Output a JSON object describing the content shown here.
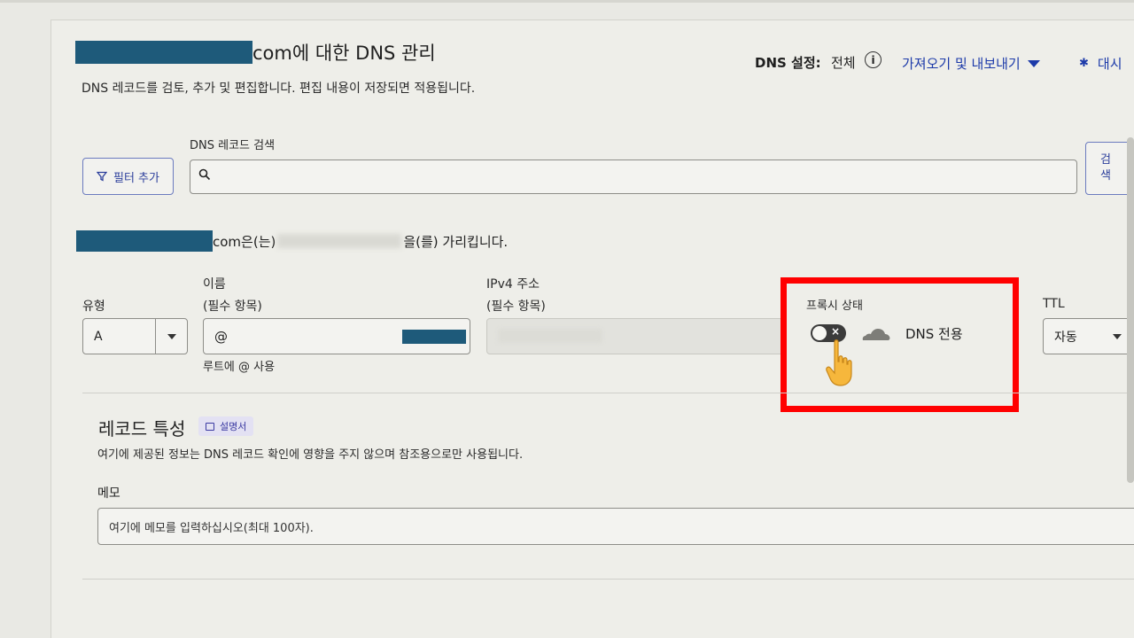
{
  "header": {
    "title_suffix": "com에 대한 DNS 관리",
    "subtitle": "DNS 레코드를 검토, 추가 및 편집합니다. 편집 내용이 저장되면 적용됩니다.",
    "dns_setting_label": "DNS 설정:",
    "dns_setting_value": "전체",
    "import_export_label": "가져오기 및 내보내기",
    "dashboard_label": "대시"
  },
  "search": {
    "label": "DNS 레코드 검색",
    "filter_label": "필터 추가",
    "button_line1": "검",
    "button_line2": "색",
    "value": ""
  },
  "record": {
    "points_suffix_1": "com은(는)",
    "points_suffix_2": "을(를) 가리킵니다.",
    "type_label": "유형",
    "type_value": "A",
    "name_label": "이름",
    "name_required": "(필수 항목)",
    "name_value": "@",
    "name_hint": "루트에 @ 사용",
    "ipv4_label": "IPv4 주소",
    "ipv4_required": "(필수 항목)",
    "proxy_label": "프록시 상태",
    "proxy_on": false,
    "proxy_value": "DNS 전용",
    "ttl_label": "TTL",
    "ttl_value": "자동"
  },
  "attributes": {
    "title": "레코드 특성",
    "doc_badge": "설명서",
    "description": "여기에 제공된 정보는 DNS 레코드 확인에 영향을 주지 않으며 참조용으로만 사용됩니다.",
    "memo_label": "메모",
    "memo_placeholder": "여기에 메모를 입력하십시오(최대 100자)."
  },
  "colors": {
    "accent": "#1c3aa9",
    "highlight": "#ff0000",
    "redaction": "#1e5a7a"
  }
}
